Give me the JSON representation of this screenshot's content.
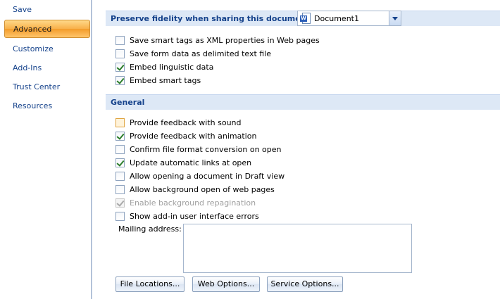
{
  "sidebar": {
    "items": [
      {
        "label": "Save",
        "selected": false
      },
      {
        "label": "Advanced",
        "selected": true
      },
      {
        "label": "Customize",
        "selected": false
      },
      {
        "label": "Add-Ins",
        "selected": false
      },
      {
        "label": "Trust Center",
        "selected": false
      },
      {
        "label": "Resources",
        "selected": false
      }
    ]
  },
  "fidelity": {
    "title": "Preserve fidelity when sharing this document:",
    "document_select": {
      "value": "Document1",
      "icon": "word-document-icon"
    },
    "options": [
      {
        "label": "Save smart tags as XML properties in Web pages",
        "checked": false
      },
      {
        "label": "Save form data as delimited text file",
        "checked": false
      },
      {
        "label": "Embed linguistic data",
        "checked": true
      },
      {
        "label": "Embed smart tags",
        "checked": true
      }
    ]
  },
  "general": {
    "title": "General",
    "options": [
      {
        "label": "Provide feedback with sound",
        "checked": false,
        "focused": true
      },
      {
        "label": "Provide feedback with animation",
        "checked": true
      },
      {
        "label": "Confirm file format conversion on open",
        "checked": false
      },
      {
        "label": "Update automatic links at open",
        "checked": true
      },
      {
        "label": "Allow opening a document in Draft view",
        "checked": false
      },
      {
        "label": "Allow background open of web pages",
        "checked": false
      },
      {
        "label": "Enable background repagination",
        "checked": true,
        "disabled": true
      },
      {
        "label": "Show add-in user interface errors",
        "checked": false
      }
    ],
    "mailing_address_label": "Mailing address:",
    "mailing_address_value": ""
  },
  "buttons": {
    "file_locations": "File Locations...",
    "web_options": "Web Options...",
    "service_options": "Service Options..."
  },
  "colors": {
    "accent": "#f8b04a",
    "header_bg": "#dde8f6",
    "header_text": "#15428b",
    "check": "#2a7d2a"
  }
}
